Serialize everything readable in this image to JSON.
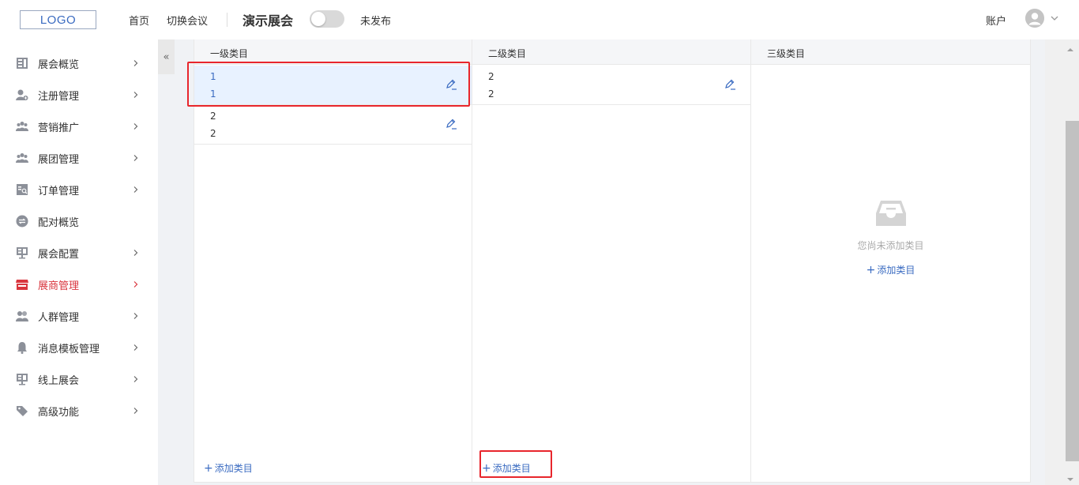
{
  "header": {
    "logo": "LOGO",
    "nav_home": "首页",
    "nav_switch": "切换会议",
    "expo_title": "演示展会",
    "publish_status": "未发布",
    "account": "账户"
  },
  "sidebar": {
    "items": [
      {
        "label": "展会概览",
        "icon": "document-icon",
        "arrow": true
      },
      {
        "label": "注册管理",
        "icon": "user-add-icon",
        "arrow": true
      },
      {
        "label": "营销推广",
        "icon": "group-icon",
        "arrow": true
      },
      {
        "label": "展团管理",
        "icon": "team-icon",
        "arrow": true
      },
      {
        "label": "订单管理",
        "icon": "order-icon",
        "arrow": true
      },
      {
        "label": "配对概览",
        "icon": "exchange-icon",
        "arrow": false
      },
      {
        "label": "展会配置",
        "icon": "config-icon",
        "arrow": true
      },
      {
        "label": "展商管理",
        "icon": "store-icon",
        "arrow": true,
        "active": true
      },
      {
        "label": "人群管理",
        "icon": "people-icon",
        "arrow": true
      },
      {
        "label": "消息模板管理",
        "icon": "bell-icon",
        "arrow": true
      },
      {
        "label": "线上展会",
        "icon": "monitor-icon",
        "arrow": true
      },
      {
        "label": "高级功能",
        "icon": "tag-icon",
        "arrow": true
      }
    ],
    "collapse": "«"
  },
  "columns": {
    "level1": {
      "title": "一级类目",
      "rows": [
        {
          "line1": "1",
          "line2": "1",
          "selected": true
        },
        {
          "line1": "2",
          "line2": "2",
          "selected": false
        }
      ],
      "add_label": "添加类目"
    },
    "level2": {
      "title": "二级类目",
      "rows": [
        {
          "line1": "2",
          "line2": "2",
          "selected": false
        }
      ],
      "add_label": "添加类目"
    },
    "level3": {
      "title": "三级类目",
      "empty_text": "您尚未添加类目",
      "add_label": "添加类目"
    }
  },
  "colors": {
    "accent": "#3a6bc1",
    "active_red": "#d9363e",
    "highlight": "#e8262c",
    "selected_bg": "#e8f2ff"
  }
}
